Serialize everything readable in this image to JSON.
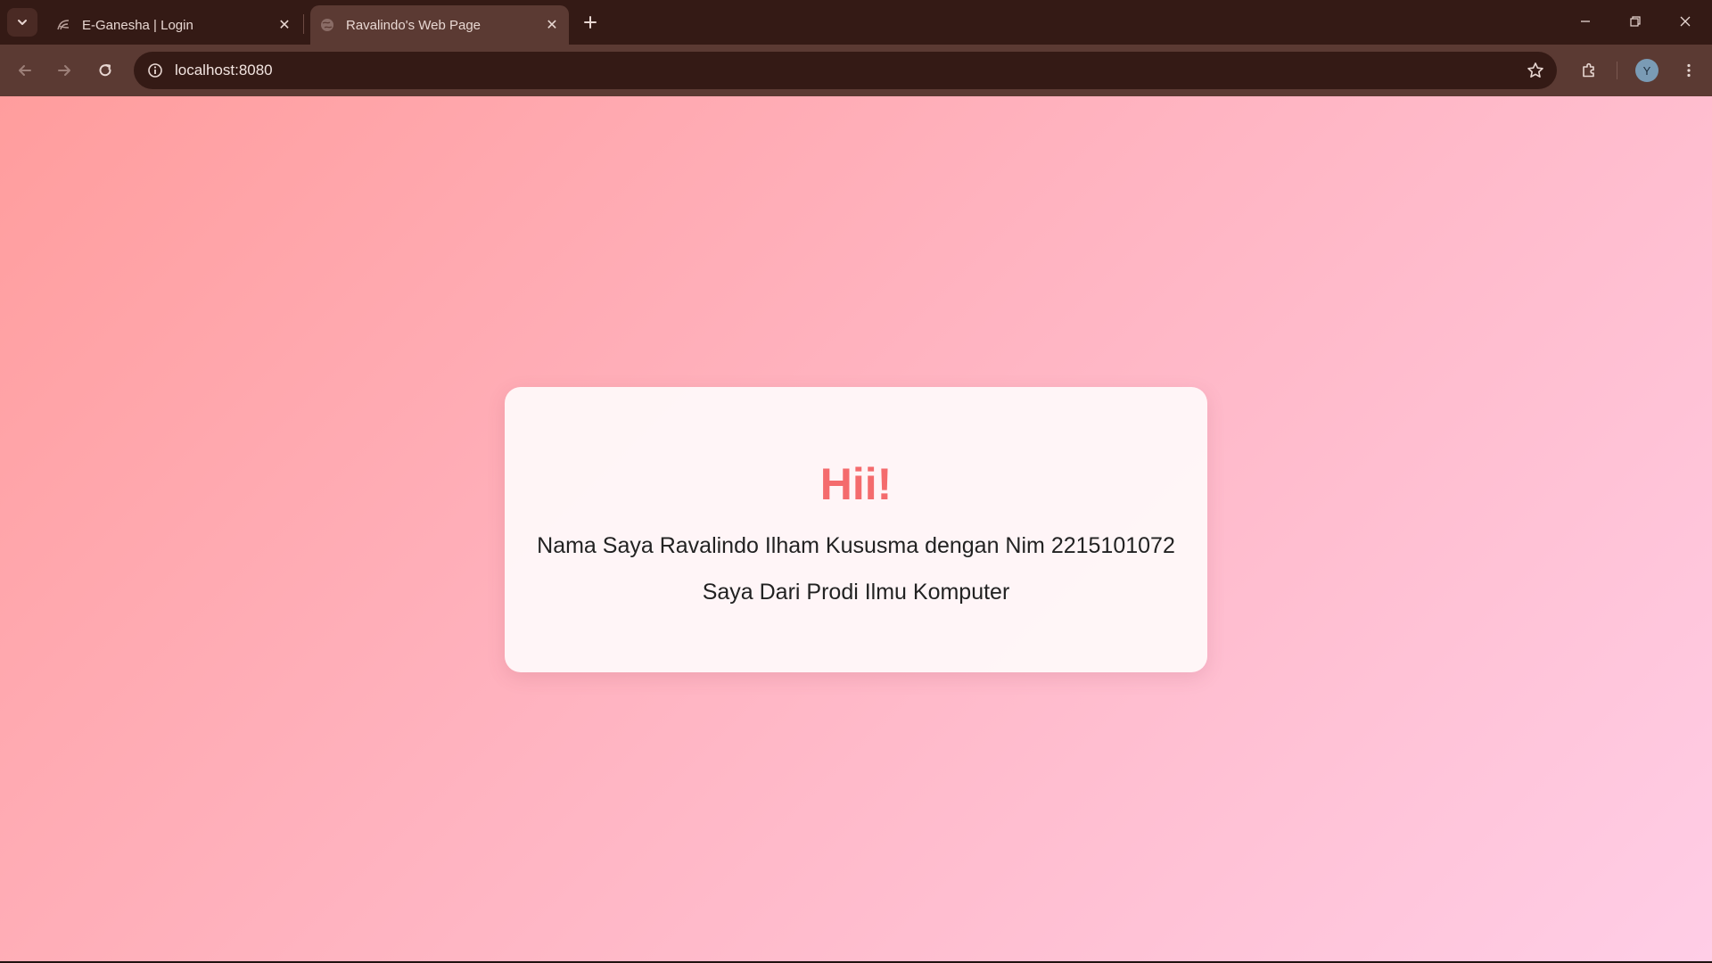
{
  "browser": {
    "tabs": [
      {
        "title": "E-Ganesha | Login",
        "icon": "e-ganesha-favicon",
        "active": false
      },
      {
        "title": "Ravalindo's Web Page",
        "icon": "globe-icon",
        "active": true
      }
    ],
    "address_bar": {
      "url": "localhost:8080"
    },
    "profile_initial": "Y"
  },
  "page": {
    "heading": "Hii!",
    "line1": "Nama Saya Ravalindo Ilham Kususma dengan Nim 2215101072",
    "line2": "Saya Dari Prodi Ilmu Komputer"
  },
  "colors": {
    "heading": "#f46b6d",
    "gradient_start": "#ff9d9d",
    "gradient_end": "#ffcde6",
    "browser_frame": "#341a15"
  }
}
